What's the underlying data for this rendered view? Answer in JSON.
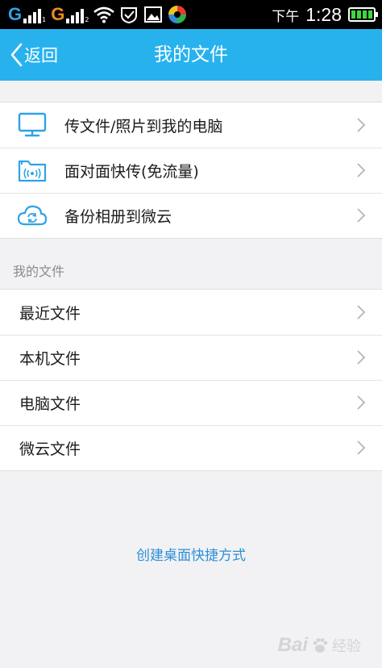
{
  "status_bar": {
    "carrier1": "G",
    "carrier1_sub": "1",
    "carrier2": "G",
    "carrier2_sub": "2",
    "time_prefix": "下午",
    "time": "1:28"
  },
  "header": {
    "back_label": "返回",
    "title": "我的文件"
  },
  "transfer_group": {
    "items": [
      {
        "label": "传文件/照片到我的电脑",
        "icon": "computer-monitor-icon"
      },
      {
        "label": "面对面快传(免流量)",
        "icon": "folder-wireless-icon"
      },
      {
        "label": "备份相册到微云",
        "icon": "cloud-sync-icon"
      }
    ]
  },
  "files_section": {
    "header": "我的文件",
    "items": [
      {
        "label": "最近文件"
      },
      {
        "label": "本机文件"
      },
      {
        "label": "电脑文件"
      },
      {
        "label": "微云文件"
      }
    ]
  },
  "shortcut_link": "创建桌面快捷方式",
  "watermark": {
    "brand": "Bai",
    "suffix": "经验"
  },
  "colors": {
    "accent": "#27b2ee",
    "link": "#2b8fd6",
    "icon_blue": "#2ea3e6"
  }
}
